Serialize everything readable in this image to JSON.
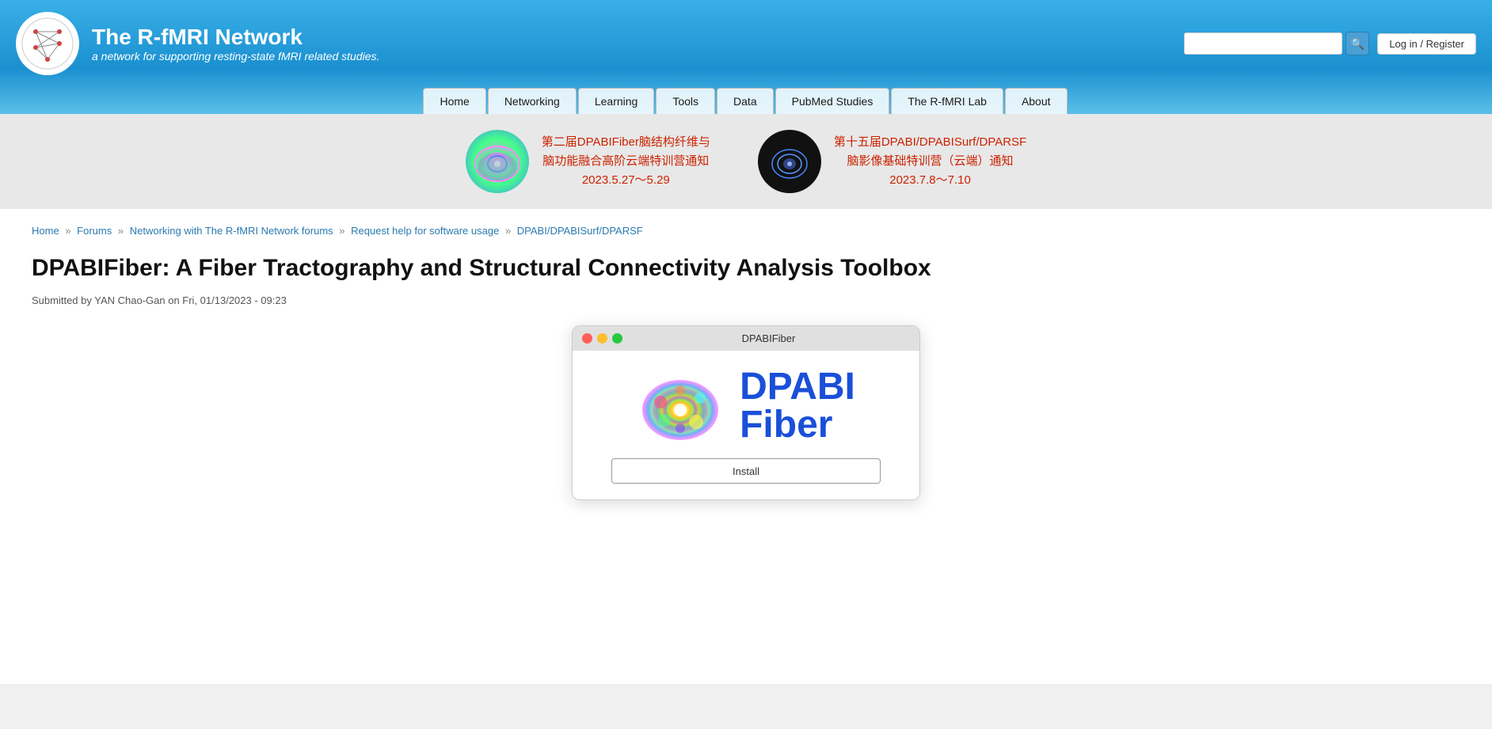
{
  "site": {
    "title": "The R-fMRI Network",
    "subtitle": "a network for supporting resting-state fMRI related studies.",
    "login_label": "Log in / Register"
  },
  "search": {
    "placeholder": "",
    "button_label": "🔍"
  },
  "nav": {
    "items": [
      {
        "label": "Home",
        "id": "home"
      },
      {
        "label": "Networking",
        "id": "networking"
      },
      {
        "label": "Learning",
        "id": "learning"
      },
      {
        "label": "Tools",
        "id": "tools"
      },
      {
        "label": "Data",
        "id": "data"
      },
      {
        "label": "PubMed Studies",
        "id": "pubmed"
      },
      {
        "label": "The R-fMRI Lab",
        "id": "lab"
      },
      {
        "label": "About",
        "id": "about"
      }
    ]
  },
  "banner": {
    "item1": {
      "title": "第二届DPABIFiber脑结构纤维与\n脑功能融合高阶云端特训营通知\n2023.5.27～5.29"
    },
    "item2": {
      "title": "第十五届DPABI/DPABISurf/DPARSF\n脑影像基础特训营（云端）通知\n2023.7.8～7.10"
    }
  },
  "breadcrumb": {
    "items": [
      {
        "label": "Home",
        "href": "#"
      },
      {
        "label": "Forums",
        "href": "#"
      },
      {
        "label": "Networking with The R-fMRI Network forums",
        "href": "#"
      },
      {
        "label": "Request help for software usage",
        "href": "#"
      },
      {
        "label": "DPABI/DPABISurf/DPARSF",
        "href": "#"
      }
    ]
  },
  "article": {
    "title": "DPABIFiber: A Fiber Tractography and Structural Connectivity Analysis Toolbox",
    "meta": "Submitted by YAN Chao-Gan on Fri, 01/13/2023 - 09:23"
  },
  "app_window": {
    "title": "DPABIFiber",
    "dpabi_text": "DPABI",
    "fiber_text": "Fiber",
    "install_label": "Install"
  }
}
